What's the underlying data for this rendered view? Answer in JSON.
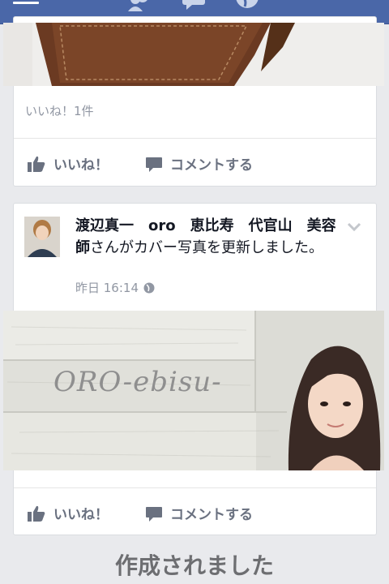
{
  "topbar": {
    "icons": [
      "menu-icon",
      "friends-icon",
      "messages-icon",
      "globe-icon"
    ],
    "bg_color": "#4a67a8"
  },
  "post1": {
    "likes_text": "いいね！1件",
    "like_label": "いいね！",
    "comment_label": "コメントする"
  },
  "post2": {
    "author_name": "渡辺真一　oro　恵比寿　代官山　美容師",
    "action_text": "さんがカバー写真を更新しました。",
    "timestamp": "昨日 16:14",
    "cover_watermark": "ORO-ebisu-",
    "like_label": "いいね！",
    "comment_label": "コメントする"
  },
  "next_heading": "作成されました"
}
